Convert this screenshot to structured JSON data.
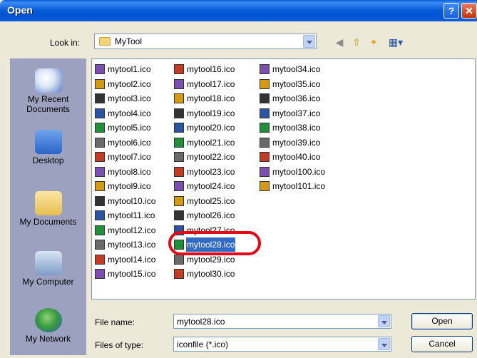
{
  "window": {
    "title": "Open"
  },
  "lookin": {
    "label": "Look in:",
    "value": "MyTool"
  },
  "toolbar": {
    "back_icon": "back-arrow-icon",
    "up_icon": "up-folder-icon",
    "newfolder_icon": "new-folder-icon",
    "views_icon": "views-menu-icon"
  },
  "places": [
    {
      "label": "My Recent Documents",
      "icon": "recent-documents-icon"
    },
    {
      "label": "Desktop",
      "icon": "desktop-icon"
    },
    {
      "label": "My Documents",
      "icon": "my-documents-icon"
    },
    {
      "label": "My Computer",
      "icon": "my-computer-icon"
    },
    {
      "label": "My Network",
      "icon": "my-network-icon"
    }
  ],
  "files": {
    "col1": [
      "mytool1.ico",
      "mytool2.ico",
      "mytool3.ico",
      "mytool4.ico",
      "mytool5.ico",
      "mytool6.ico",
      "mytool7.ico",
      "mytool8.ico",
      "mytool9.ico",
      "mytool10.ico",
      "mytool11.ico",
      "mytool12.ico",
      "mytool13.ico",
      "mytool14.ico",
      "mytool15.ico"
    ],
    "col2": [
      "mytool16.ico",
      "mytool17.ico",
      "mytool18.ico",
      "mytool19.ico",
      "mytool20.ico",
      "mytool21.ico",
      "mytool22.ico",
      "mytool23.ico",
      "mytool24.ico",
      "mytool25.ico",
      "mytool26.ico",
      "mytool27.ico",
      "mytool28.ico",
      "mytool29.ico",
      "mytool30.ico"
    ],
    "col3": [
      "mytool34.ico",
      "mytool35.ico",
      "mytool36.ico",
      "mytool37.ico",
      "mytool38.ico",
      "mytool39.ico",
      "mytool40.ico",
      "mytool100.ico",
      "mytool101.ico"
    ],
    "selected": "mytool28.ico"
  },
  "filename": {
    "label": "File name:",
    "value": "mytool28.ico"
  },
  "filetype": {
    "label": "Files of type:",
    "value": "iconfile (*.ico)"
  },
  "buttons": {
    "open": "Open",
    "cancel": "Cancel"
  },
  "colors": {
    "selection": "#316ac5",
    "highlight_ring": "#e20a16",
    "titlebar": "#0a5fd8"
  }
}
